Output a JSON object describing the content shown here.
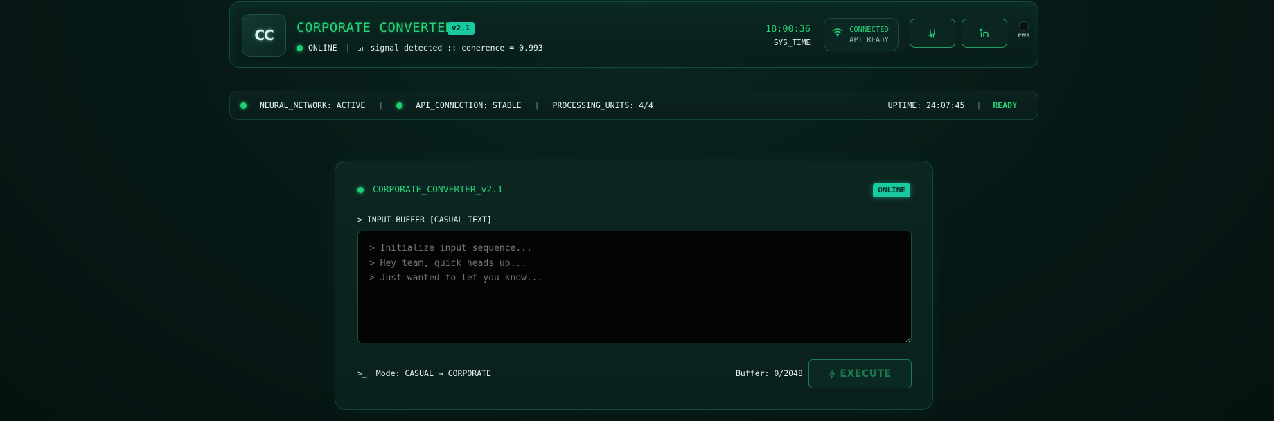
{
  "header": {
    "logo_text": "CC",
    "title": "CORPORATE CONVERTER",
    "version": "v2.1",
    "status": "ONLINE",
    "signal_text": "signal detected :: coherence = 0.993",
    "time": "18:00:36",
    "time_label": "SYS_TIME",
    "connection_status": "CONNECTED",
    "connection_sub": "API_READY",
    "github_icon": "github-icon",
    "linkedin_icon": "linkedin-icon",
    "power_label": "PWR"
  },
  "statusbar": {
    "neural": "NEURAL_NETWORK: ACTIVE",
    "api": "API_CONNECTION: STABLE",
    "units": "PROCESSING_UNITS: 4/4",
    "uptime": "UPTIME: 24:07:45",
    "ready": "READY"
  },
  "panel": {
    "title": "CORPORATE_CONVERTER_v2.1",
    "badge": "ONLINE",
    "input_label": "> INPUT BUFFER [CASUAL TEXT]",
    "placeholder": "> Initialize input sequence...\n> Hey team, quick heads up...\n> Just wanted to let you know...",
    "mode_prefix": ">_",
    "mode": "Mode: CASUAL → CORPORATE",
    "buffer": "Buffer: 0/2048",
    "execute_label": "EXECUTE"
  },
  "colors": {
    "accent": "#25d377",
    "badge": "#19c9a0",
    "background": "#071a17"
  }
}
